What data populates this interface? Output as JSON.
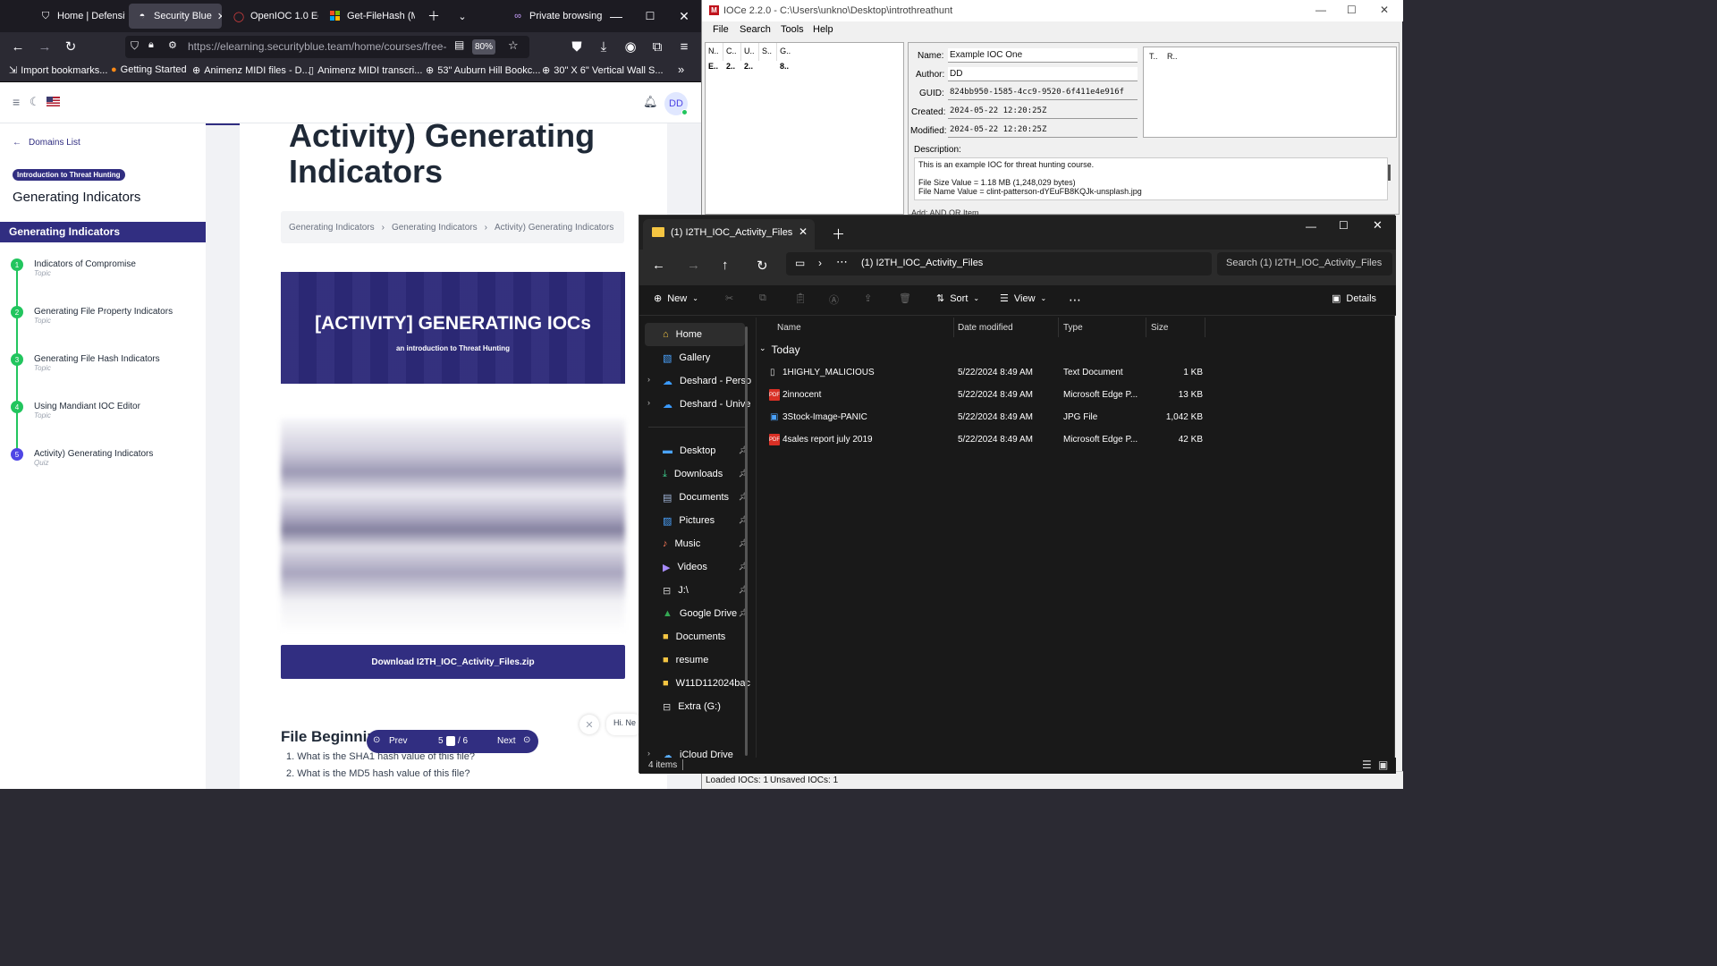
{
  "firefox": {
    "tabs": [
      {
        "label": "Home | Defensiv",
        "icon": "shield-icon"
      },
      {
        "label": "Security Blue",
        "icon": "mask-icon"
      },
      {
        "label": "OpenIOC 1.0 Edi",
        "icon": "circle-icon"
      },
      {
        "label": "Get-FileHash (M",
        "icon": "microsoft-icon"
      }
    ],
    "private_label": "Private browsing",
    "url": "https://elearning.securityblue.team/home/courses/free-co",
    "zoom": "80%",
    "bookmarks": [
      "Import bookmarks...",
      "Getting Started",
      "Animenz MIDI files - D...",
      "Animenz MIDI transcri...",
      "53\" Auburn Hill Bookc...",
      "30\" X 6\" Vertical Wall S..."
    ]
  },
  "site": {
    "avatar": "DD",
    "back_label": "Domains List",
    "course_badge": "Introduction to Threat Hunting",
    "course_title": "Generating Indicators",
    "section_title": "Generating Indicators",
    "steps": [
      {
        "num": "1",
        "title": "Indicators of Compromise",
        "kind": "Topic"
      },
      {
        "num": "2",
        "title": "Generating File Property Indicators",
        "kind": "Topic"
      },
      {
        "num": "3",
        "title": "Generating File Hash Indicators",
        "kind": "Topic"
      },
      {
        "num": "4",
        "title": "Using Mandiant IOC Editor",
        "kind": "Topic"
      },
      {
        "num": "5",
        "title": "Activity) Generating Indicators",
        "kind": "Quiz"
      }
    ],
    "heading_line1": "Activity) Generating",
    "heading_line2": "Indicators",
    "breadcrumb": [
      "Generating Indicators",
      "Generating Indicators",
      "Activity) Generating Indicators"
    ],
    "banner_title": "[ACTIVITY] GENERATING IOCs",
    "banner_subtitle": "an introduction to Threat Hunting",
    "download_label": "Download I2TH_IOC_Activity_Files.zip",
    "section_heading": "File Beginnin",
    "questions": [
      "1. What is the SHA1 hash value of this file?",
      "2. What is the MD5 hash value of this file?"
    ],
    "pager": {
      "prev": "Prev",
      "current": "5",
      "total": "/ 6",
      "next": "Next"
    },
    "chat_text": "Hi. Ne"
  },
  "ioce": {
    "title": "IOCe 2.2.0 - C:\\Users\\unkno\\Desktop\\introthreathunt",
    "menus": [
      "File",
      "Search",
      "Tools",
      "Help"
    ],
    "list_headers": [
      "N..",
      "C..",
      "U..",
      "S..",
      "G.."
    ],
    "list_row": [
      "E..",
      "2..",
      "2..",
      "",
      "8.."
    ],
    "fields": {
      "name_label": "Name:",
      "name": "Example IOC One",
      "author_label": "Author:",
      "author": "DD",
      "guid_label": "GUID:",
      "guid": "824bb950-1585-4cc9-9520-6f411e4e916f",
      "created_label": "Created:",
      "created": "2024-05-22 12:20:25Z",
      "modified_label": "Modified:",
      "modified": "2024-05-22 12:20:25Z",
      "desc_label": "Description:"
    },
    "side_headers": [
      "T..",
      "R.."
    ],
    "description": [
      "This is an example IOC for threat hunting course.",
      "File Size Value = 1.18 MB (1,248,029 bytes)",
      "File Name Value = clint-patterson-dYEuFB8KQJk-unsplash.jpg"
    ],
    "add_bar": "Add:  AND   OR   Item",
    "status": [
      "Loaded IOCs: 1",
      "Unsaved IOCs: 1"
    ]
  },
  "explorer": {
    "tab_title": "(1) I2TH_IOC_Activity_Files",
    "path": "(1) I2TH_IOC_Activity_Files",
    "search_placeholder": "Search (1) I2TH_IOC_Activity_Files",
    "toolbar": {
      "new": "New",
      "sort": "Sort",
      "view": "View",
      "details": "Details"
    },
    "nav": [
      {
        "label": "Home",
        "icon": "home-icon",
        "pinned": false
      },
      {
        "label": "Gallery",
        "icon": "gallery-icon",
        "pinned": false
      },
      {
        "label": "Deshard - Perso",
        "icon": "cloud-icon",
        "pinned": false
      },
      {
        "label": "Deshard - Unive",
        "icon": "cloud-icon",
        "pinned": false
      },
      {
        "label": "Desktop",
        "icon": "desktop-icon",
        "pinned": true
      },
      {
        "label": "Downloads",
        "icon": "download-icon",
        "pinned": true
      },
      {
        "label": "Documents",
        "icon": "document-icon",
        "pinned": true
      },
      {
        "label": "Pictures",
        "icon": "picture-icon",
        "pinned": true
      },
      {
        "label": "Music",
        "icon": "music-icon",
        "pinned": true
      },
      {
        "label": "Videos",
        "icon": "video-icon",
        "pinned": true
      },
      {
        "label": "J:\\",
        "icon": "drive-icon",
        "pinned": true
      },
      {
        "label": "Google Drive",
        "icon": "google-drive-icon",
        "pinned": true
      },
      {
        "label": "Documents",
        "icon": "folder-icon",
        "pinned": false
      },
      {
        "label": "resume",
        "icon": "folder-icon",
        "pinned": false
      },
      {
        "label": "W11D112024bac",
        "icon": "folder-icon",
        "pinned": false
      },
      {
        "label": "Extra (G:)",
        "icon": "drive-icon",
        "pinned": false
      },
      {
        "label": "iCloud Drive",
        "icon": "cloud-icon",
        "pinned": false
      }
    ],
    "columns": [
      "Name",
      "Date modified",
      "Type",
      "Size"
    ],
    "group": "Today",
    "files": [
      {
        "name": "1HIGHLY_MALICIOUS",
        "date": "5/22/2024 8:49 AM",
        "type": "Text Document",
        "size": "1 KB",
        "icon": "text-file-icon"
      },
      {
        "name": "2innocent",
        "date": "5/22/2024 8:49 AM",
        "type": "Microsoft Edge P...",
        "size": "13 KB",
        "icon": "pdf-file-icon"
      },
      {
        "name": "3Stock-Image-PANIC",
        "date": "5/22/2024 8:49 AM",
        "type": "JPG File",
        "size": "1,042 KB",
        "icon": "image-file-icon"
      },
      {
        "name": "4sales report july 2019",
        "date": "5/22/2024 8:49 AM",
        "type": "Microsoft Edge P...",
        "size": "42 KB",
        "icon": "pdf-file-icon"
      }
    ],
    "status": "4 items"
  }
}
